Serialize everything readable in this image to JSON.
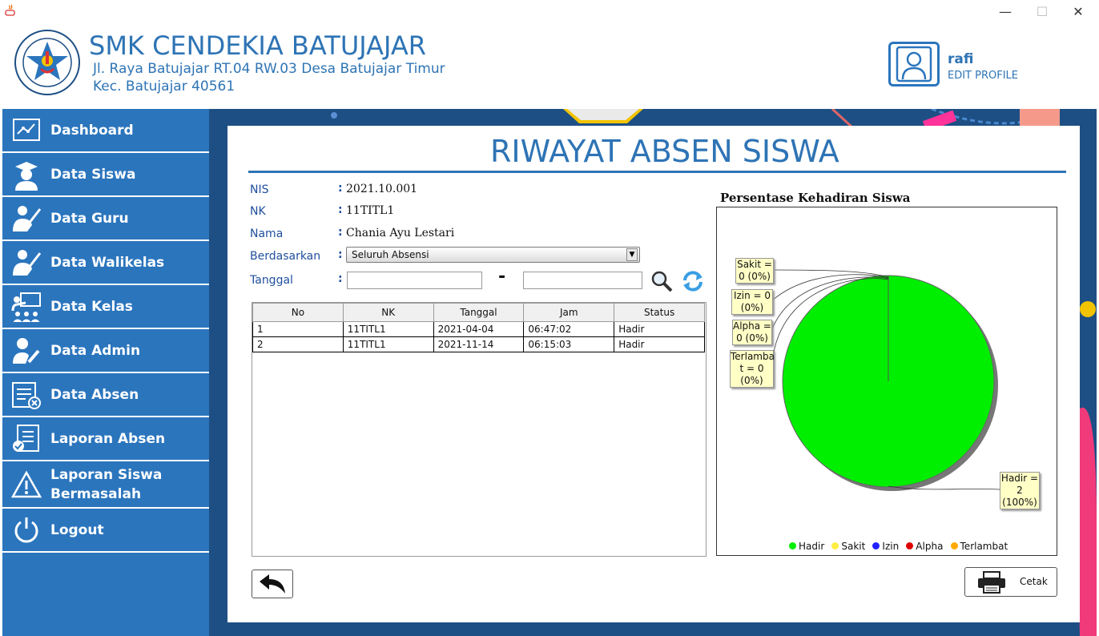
{
  "header": {
    "school_name": "SMK CENDEKIA BATUJAJAR",
    "address_line1": "Jl. Raya Batujajar RT.04 RW.03 Desa Batujajar Timur",
    "address_line2": "Kec. Batujajar 40561",
    "logo_text_top": "SMK CENDEKIA BATUJAJAR",
    "logo_text_bottom": "YAYASAN PUTRA CENDEKIA",
    "user_name": "rafi",
    "edit_profile": "EDIT PROFILE"
  },
  "window": {
    "minimize": "—",
    "maximize": "☐",
    "close": "✕"
  },
  "sidebar": {
    "items": [
      {
        "label": "Dashboard",
        "icon": "dashboard-icon"
      },
      {
        "label": "Data Siswa",
        "icon": "student-icon"
      },
      {
        "label": "Data Guru",
        "icon": "teacher-icon"
      },
      {
        "label": "Data Walikelas",
        "icon": "homeroom-teacher-icon"
      },
      {
        "label": "Data Kelas",
        "icon": "classroom-icon"
      },
      {
        "label": "Data Admin",
        "icon": "admin-icon"
      },
      {
        "label": "Data Absen",
        "icon": "attendance-icon"
      },
      {
        "label": "Laporan Absen",
        "icon": "report-icon"
      },
      {
        "label": "Laporan Siswa",
        "label2": "Bermasalah",
        "icon": "warning-icon"
      },
      {
        "label": "Logout",
        "icon": "power-icon"
      }
    ]
  },
  "main": {
    "title": "RIWAYAT ABSEN SISWA",
    "fields": {
      "nis_label": "NIS",
      "nis_value": "2021.10.001",
      "nk_label": "NK",
      "nk_value": "11TITL1",
      "nama_label": "Nama",
      "nama_value": "Chania Ayu Lestari",
      "berdasarkan_label": "Berdasarkan",
      "berdasarkan_value": "Seluruh Absensi",
      "tanggal_label": "Tanggal",
      "tanggal_from": "",
      "tanggal_to": "",
      "colon": ":",
      "dash": "-"
    },
    "table": {
      "headers": [
        "No",
        "NK",
        "Tanggal",
        "Jam",
        "Status"
      ],
      "rows": [
        [
          "1",
          "11TITL1",
          "2021-04-04",
          "06:47:02",
          "Hadir"
        ],
        [
          "2",
          "11TITL1",
          "2021-11-14",
          "06:15:03",
          "Hadir"
        ]
      ]
    },
    "print_label": "Cetak"
  },
  "chart_data": {
    "type": "pie",
    "title": "Persentase Kehadiran Siswa",
    "categories": [
      "Hadir",
      "Sakit",
      "Izin",
      "Alpha",
      "Terlambat"
    ],
    "values": [
      2,
      0,
      0,
      0,
      0
    ],
    "colors": [
      "#00ee00",
      "#ffee44",
      "#2222ff",
      "#dd0000",
      "#ffaa00"
    ],
    "labels": {
      "sakit": [
        "Sakit =",
        "0 (0%)"
      ],
      "izin": [
        "Izin = 0",
        "(0%)"
      ],
      "alpha": [
        "Alpha =",
        "0 (0%)"
      ],
      "terlambat": [
        "Terlamba",
        "t = 0",
        "(0%)"
      ],
      "hadir": [
        "Hadir =",
        "2",
        "(100%)"
      ]
    },
    "legend": "bottom"
  }
}
